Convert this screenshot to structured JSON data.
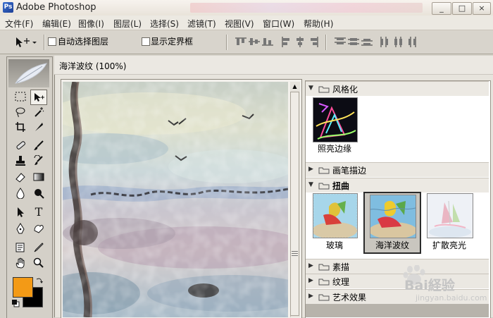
{
  "window": {
    "title": "Adobe Photoshop",
    "icon": "photoshop-app-icon",
    "buttons": [
      "_",
      "□",
      "×"
    ]
  },
  "menu": [
    "文件(F)",
    "编辑(E)",
    "图像(I)",
    "图层(L)",
    "选择(S)",
    "滤镜(T)",
    "视图(V)",
    "窗口(W)",
    "帮助(H)"
  ],
  "options": {
    "auto_select_label": "自动选择图层",
    "auto_select_checked": false,
    "show_bounds_label": "显示定界框",
    "show_bounds_checked": false,
    "tool_icon": "move-tool-icon",
    "align_icons": [
      "align-top-icon",
      "align-vcenter-icon",
      "align-bottom-icon",
      "align-left-icon",
      "align-hcenter-icon",
      "align-right-icon",
      "distribute-top-icon",
      "distribute-vcenter-icon",
      "distribute-bottom-icon",
      "distribute-left-icon",
      "distribute-hcenter-icon",
      "distribute-right-icon"
    ]
  },
  "toolbox": {
    "foreground_color": "#f39a16",
    "background_color": "#000000",
    "tools": [
      "marquee",
      "move",
      "lasso",
      "magic-wand",
      "crop",
      "slice",
      "healing",
      "brush",
      "stamp",
      "history-brush",
      "eraser",
      "gradient",
      "blur",
      "dodge",
      "path-select",
      "type",
      "pen",
      "shape",
      "notes",
      "eyedropper",
      "hand",
      "zoom"
    ]
  },
  "dialog": {
    "title": "海洋波纹 (100%)"
  },
  "gallery": {
    "categories": [
      {
        "label": "风格化",
        "expanded": true,
        "thumbs": [
          {
            "label": "照亮边缘",
            "selected": false
          }
        ]
      },
      {
        "label": "画笔描边",
        "expanded": false
      },
      {
        "label": "扭曲",
        "expanded": true,
        "thumbs": [
          {
            "label": "玻璃",
            "selected": false
          },
          {
            "label": "海洋波纹",
            "selected": true
          },
          {
            "label": "扩散亮光",
            "selected": false
          }
        ]
      },
      {
        "label": "素描",
        "expanded": false
      },
      {
        "label": "纹理",
        "expanded": false
      },
      {
        "label": "艺术效果",
        "expanded": false
      }
    ]
  },
  "watermark": {
    "text": "Bai経验",
    "site": "jingyan.baidu.com"
  }
}
